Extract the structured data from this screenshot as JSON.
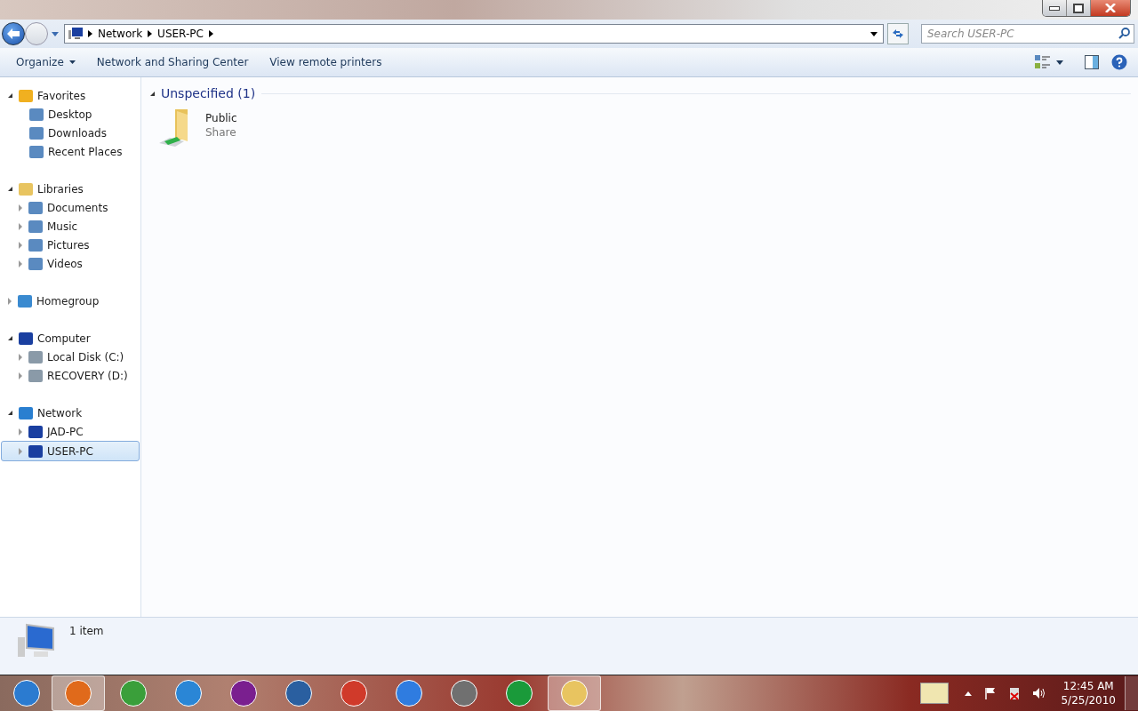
{
  "address_bar": {
    "breadcrumbs": [
      "Network",
      "USER-PC"
    ]
  },
  "search": {
    "placeholder": "Search USER-PC"
  },
  "command_bar": {
    "items": [
      "Organize",
      "Network and Sharing Center",
      "View remote printers"
    ]
  },
  "sidebar": {
    "groups": [
      {
        "label": "Favorites",
        "expanded": true,
        "selected": false,
        "children": [
          {
            "label": "Desktop",
            "selected": false
          },
          {
            "label": "Downloads",
            "selected": false
          },
          {
            "label": "Recent Places",
            "selected": false
          }
        ]
      },
      {
        "label": "Libraries",
        "expanded": true,
        "selected": false,
        "children": [
          {
            "label": "Documents",
            "expanded": false,
            "selected": false
          },
          {
            "label": "Music",
            "expanded": false,
            "selected": false
          },
          {
            "label": "Pictures",
            "expanded": false,
            "selected": false
          },
          {
            "label": "Videos",
            "expanded": false,
            "selected": false
          }
        ]
      },
      {
        "label": "Homegroup",
        "expanded": false,
        "selected": false
      },
      {
        "label": "Computer",
        "expanded": true,
        "selected": false,
        "children": [
          {
            "label": "Local Disk (C:)",
            "expanded": false,
            "selected": false
          },
          {
            "label": "RECOVERY (D:)",
            "expanded": false,
            "selected": false
          }
        ]
      },
      {
        "label": "Network",
        "expanded": true,
        "selected": false,
        "children": [
          {
            "label": "JAD-PC",
            "expanded": false,
            "selected": false
          },
          {
            "label": "USER-PC",
            "expanded": false,
            "selected": true
          }
        ]
      }
    ]
  },
  "content": {
    "group": {
      "title": "Unspecified (1)",
      "expanded": true
    },
    "items": [
      {
        "name": "Public",
        "type": "Share"
      }
    ]
  },
  "details_pane": {
    "text": "1 item"
  },
  "taskbar": {
    "apps": [
      {
        "running": true
      },
      {
        "running": false
      },
      {
        "running": false
      },
      {
        "running": false
      },
      {
        "running": false
      },
      {
        "running": false
      },
      {
        "running": false
      },
      {
        "running": false
      },
      {
        "running": false
      },
      {
        "running": true
      }
    ],
    "clock": {
      "time": "12:45 AM",
      "date": "5/25/2010"
    }
  }
}
